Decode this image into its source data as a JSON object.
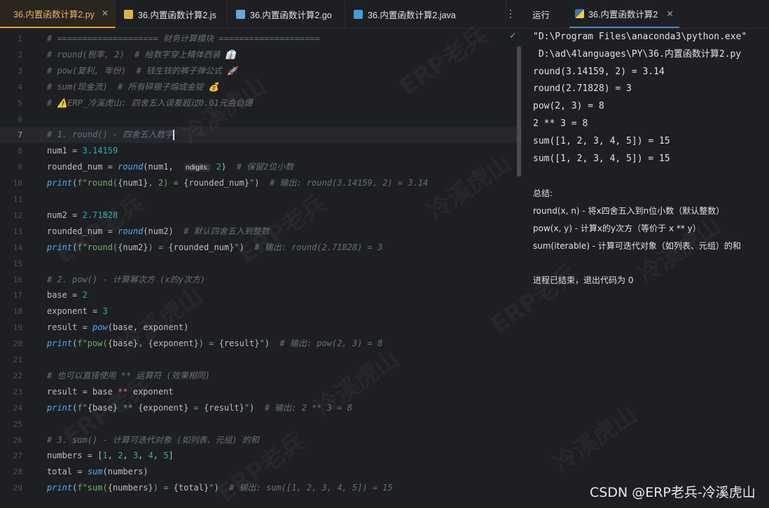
{
  "tabs": [
    {
      "label": "36.内置函数计算2.py",
      "icon": "python-icon",
      "color": "#e0a030",
      "active": true
    },
    {
      "label": "36.内置函数计算2.js",
      "icon": "js-icon",
      "color": "#d9b44a"
    },
    {
      "label": "36.内置函数计算2.go",
      "icon": "go-icon",
      "color": "#6aa7d8"
    },
    {
      "label": "36.内置函数计算2.java",
      "icon": "java-icon",
      "color": "#3f9fd6"
    }
  ],
  "run_panel": {
    "label": "运行",
    "tab_label": "36.内置函数计算2",
    "output": [
      "\"D:\\Program Files\\anaconda3\\python.exe\"",
      " D:\\ad\\4languages\\PY\\36.内置函数计算2.py",
      "round(3.14159, 2) = 3.14",
      "round(2.71828) = 3",
      "pow(2, 3) = 8",
      "2 ** 3 = 8",
      "sum([1, 2, 3, 4, 5]) = 15",
      "sum([1, 2, 3, 4, 5]) = 15",
      "",
      "总结:",
      "round(x, n) - 将x四舍五入到n位小数（默认整数）",
      "pow(x, y) - 计算x的y次方（等价于 x ** y）",
      "sum(iterable) - 计算可迭代对象（如列表、元组）的和",
      "",
      "进程已结束，退出代码为 0"
    ]
  },
  "editor": {
    "current_line": 7,
    "lines": [
      "# ==================== 财务计算模块 ====================",
      "# round(税率, 2)  # 给数字穿上精体西装 👔",
      "# pow(复利, 年份)  # 钱生钱的裤子弹公式 🚀",
      "# sum(现金流)  # 所有碎银子熔成金锭 💰",
      "# ⚠️ERP_冷溪虎山: 四舍五入误差超过0.01元会自爆",
      "",
      "# 1. round() - 四舍五入数字",
      "num1 = 3.14159",
      "rounded_num = round(num1,  ndigits: 2)  # 保留2位小数",
      "print(f\"round({num1}, 2) = {rounded_num}\")  # 输出: round(3.14159, 2) = 3.14",
      "",
      "num2 = 2.71828",
      "rounded_num = round(num2)  # 默认四舍五入到整数",
      "print(f\"round({num2}) = {rounded_num}\")  # 输出: round(2.71828) = 3",
      "",
      "# 2. pow() - 计算幂次方 (x的y次方)",
      "base = 2",
      "exponent = 3",
      "result = pow(base, exponent)",
      "print(f\"pow({base}, {exponent}) = {result}\")  # 输出: pow(2, 3) = 8",
      "",
      "# 也可以直接使用 ** 运算符 (效果相同)",
      "result = base ** exponent",
      "print(f\"{base} ** {exponent} = {result}\")  # 输出: 2 ** 3 = 8",
      "",
      "# 3. sum() - 计算可迭代对象 (如列表、元组) 的和",
      "numbers = [1, 2, 3, 4, 5]",
      "total = sum(numbers)",
      "print(f\"sum({numbers}) = {total}\")  # 输出: sum([1, 2, 3, 4, 5]) = 15"
    ]
  },
  "watermark": {
    "texts": [
      "ERP老兵",
      "冷溪虎山"
    ]
  },
  "credit": "CSDN @ERP老兵-冷溪虎山"
}
